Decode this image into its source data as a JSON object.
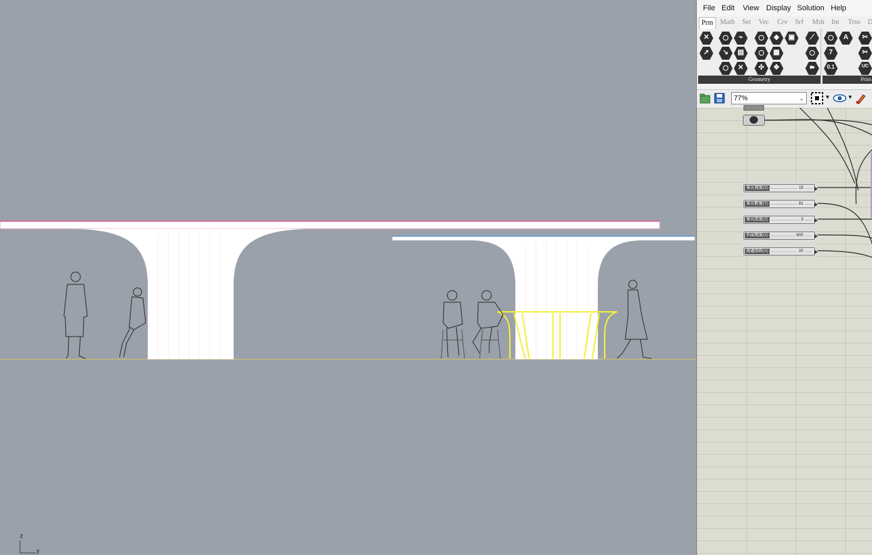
{
  "viewport": {
    "axis_z": "z",
    "axis_y": "y",
    "highlight_color": "#f5f03a",
    "background_color": "#9aa1aa"
  },
  "grasshopper": {
    "menu": [
      "File",
      "Edit",
      "View",
      "Display",
      "Solution",
      "Help"
    ],
    "tabs": [
      "Prm",
      "Math",
      "Set",
      "Vec",
      "Crv",
      "Srf",
      "Msh",
      "Int",
      "Trns",
      "D"
    ],
    "active_tab": "Prm",
    "ribbon_panel_label": "Geometry",
    "ribbon_panel_label_2": "Prim",
    "ribbon_icons_panel2": [
      "7",
      "0.1",
      "A",
      "UC"
    ],
    "zoom_value": "77%",
    "sliders": [
      {
        "label": "單元寬度(X)",
        "value": "15"
      },
      {
        "label": "單元數量(Y)",
        "value": "81"
      },
      {
        "label": "單元厚度(Z)",
        "value": "3"
      },
      {
        "label": "外圍寬度(X)",
        "value": "600"
      },
      {
        "label": "周邊間距(X)",
        "value": "20"
      }
    ]
  }
}
